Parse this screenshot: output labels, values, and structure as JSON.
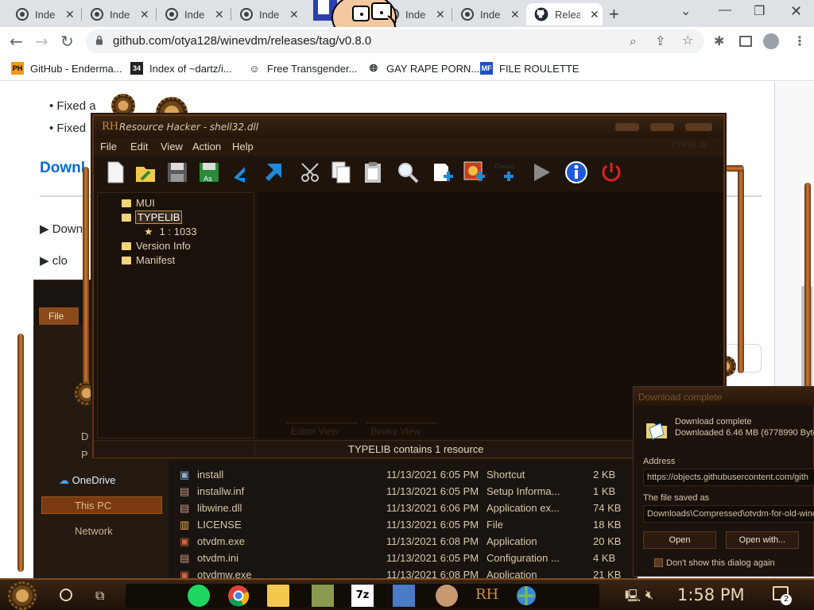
{
  "browser": {
    "tabs": [
      {
        "label": "Inde"
      },
      {
        "label": "Inde"
      },
      {
        "label": "Inde"
      },
      {
        "label": "Inde"
      },
      {
        "label": "Inde"
      },
      {
        "label": "Inde"
      },
      {
        "label": "Relea"
      }
    ],
    "url": "github.com/otya128/winevdm/releases/tag/v0.8.0",
    "bookmarks": [
      {
        "label": "GitHub - Enderma..."
      },
      {
        "label": "Index of ~dartz/i..."
      },
      {
        "label": "Free Transgender..."
      },
      {
        "label": "GAY RAPE PORN..."
      },
      {
        "label": "FILE ROULETTE"
      }
    ]
  },
  "webpage": {
    "bullets": [
      "Fixed a",
      "Fixed"
    ],
    "heading": "Downl",
    "disclosures": [
      "Down",
      "clo"
    ]
  },
  "resource_hacker": {
    "title": "Resource Hacker - shell32.dll",
    "menu": [
      "File",
      "Edit",
      "View",
      "Action",
      "Help"
    ],
    "top_right": "TYPELIB",
    "tree": [
      {
        "label": "MUI"
      },
      {
        "label": "TYPELIB"
      },
      {
        "label": "1 : 1033"
      },
      {
        "label": "Version Info"
      },
      {
        "label": "Manifest"
      }
    ],
    "editor_tab": "Editor View",
    "binary_tab": "Binary View",
    "status": "TYPELIB contains 1 resource"
  },
  "explorer": {
    "menu_file": "File",
    "nav": [
      {
        "label": "OneDrive"
      },
      {
        "label": "This PC"
      },
      {
        "label": "Network"
      }
    ],
    "nav_short": [
      {
        "label": "D"
      },
      {
        "label": "P"
      }
    ],
    "files": [
      {
        "name": "install",
        "date": "11/13/2021 6:05 PM",
        "type": "Shortcut",
        "size": "2 KB"
      },
      {
        "name": "installw.inf",
        "date": "11/13/2021 6:05 PM",
        "type": "Setup Informa...",
        "size": "1 KB"
      },
      {
        "name": "libwine.dll",
        "date": "11/13/2021 6:06 PM",
        "type": "Application ex...",
        "size": "74 KB"
      },
      {
        "name": "LICENSE",
        "date": "11/13/2021 6:05 PM",
        "type": "File",
        "size": "18 KB"
      },
      {
        "name": "otvdm.exe",
        "date": "11/13/2021 6:08 PM",
        "type": "Application",
        "size": "20 KB"
      },
      {
        "name": "otvdm.ini",
        "date": "11/13/2021 6:05 PM",
        "type": "Configuration ...",
        "size": "4 KB"
      },
      {
        "name": "otvdmw.exe",
        "date": "11/13/2021 6:08 PM",
        "type": "Application",
        "size": "21 KB"
      }
    ]
  },
  "download_dialog": {
    "title": "Download complete",
    "heading": "Download complete",
    "detail": "Downloaded 6.46 MB (6778990 Byte",
    "address_label": "Address",
    "address": "https://objects.githubusercontent.com/gith",
    "saved_label": "The file saved as",
    "saved_path": "Downloads\\Compressed\\otvdm-for-old-wind",
    "open": "Open",
    "open_with": "Open with...",
    "dont_show": "Don't show this dialog again"
  },
  "taskbar": {
    "clock": "1:58 PM",
    "notification_count": "2",
    "pinned_rh": "RH",
    "pinned_7z": "7z"
  }
}
